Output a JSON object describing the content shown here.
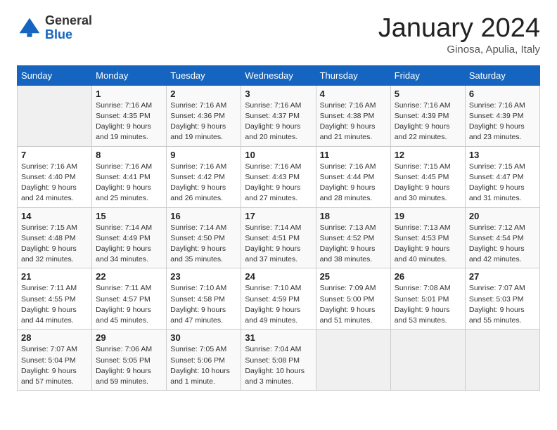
{
  "header": {
    "logo_general": "General",
    "logo_blue": "Blue",
    "month_title": "January 2024",
    "subtitle": "Ginosa, Apulia, Italy"
  },
  "days_of_week": [
    "Sunday",
    "Monday",
    "Tuesday",
    "Wednesday",
    "Thursday",
    "Friday",
    "Saturday"
  ],
  "weeks": [
    [
      {
        "num": "",
        "detail": ""
      },
      {
        "num": "1",
        "detail": "Sunrise: 7:16 AM\nSunset: 4:35 PM\nDaylight: 9 hours\nand 19 minutes."
      },
      {
        "num": "2",
        "detail": "Sunrise: 7:16 AM\nSunset: 4:36 PM\nDaylight: 9 hours\nand 19 minutes."
      },
      {
        "num": "3",
        "detail": "Sunrise: 7:16 AM\nSunset: 4:37 PM\nDaylight: 9 hours\nand 20 minutes."
      },
      {
        "num": "4",
        "detail": "Sunrise: 7:16 AM\nSunset: 4:38 PM\nDaylight: 9 hours\nand 21 minutes."
      },
      {
        "num": "5",
        "detail": "Sunrise: 7:16 AM\nSunset: 4:39 PM\nDaylight: 9 hours\nand 22 minutes."
      },
      {
        "num": "6",
        "detail": "Sunrise: 7:16 AM\nSunset: 4:39 PM\nDaylight: 9 hours\nand 23 minutes."
      }
    ],
    [
      {
        "num": "7",
        "detail": "Sunrise: 7:16 AM\nSunset: 4:40 PM\nDaylight: 9 hours\nand 24 minutes."
      },
      {
        "num": "8",
        "detail": "Sunrise: 7:16 AM\nSunset: 4:41 PM\nDaylight: 9 hours\nand 25 minutes."
      },
      {
        "num": "9",
        "detail": "Sunrise: 7:16 AM\nSunset: 4:42 PM\nDaylight: 9 hours\nand 26 minutes."
      },
      {
        "num": "10",
        "detail": "Sunrise: 7:16 AM\nSunset: 4:43 PM\nDaylight: 9 hours\nand 27 minutes."
      },
      {
        "num": "11",
        "detail": "Sunrise: 7:16 AM\nSunset: 4:44 PM\nDaylight: 9 hours\nand 28 minutes."
      },
      {
        "num": "12",
        "detail": "Sunrise: 7:15 AM\nSunset: 4:45 PM\nDaylight: 9 hours\nand 30 minutes."
      },
      {
        "num": "13",
        "detail": "Sunrise: 7:15 AM\nSunset: 4:47 PM\nDaylight: 9 hours\nand 31 minutes."
      }
    ],
    [
      {
        "num": "14",
        "detail": "Sunrise: 7:15 AM\nSunset: 4:48 PM\nDaylight: 9 hours\nand 32 minutes."
      },
      {
        "num": "15",
        "detail": "Sunrise: 7:14 AM\nSunset: 4:49 PM\nDaylight: 9 hours\nand 34 minutes."
      },
      {
        "num": "16",
        "detail": "Sunrise: 7:14 AM\nSunset: 4:50 PM\nDaylight: 9 hours\nand 35 minutes."
      },
      {
        "num": "17",
        "detail": "Sunrise: 7:14 AM\nSunset: 4:51 PM\nDaylight: 9 hours\nand 37 minutes."
      },
      {
        "num": "18",
        "detail": "Sunrise: 7:13 AM\nSunset: 4:52 PM\nDaylight: 9 hours\nand 38 minutes."
      },
      {
        "num": "19",
        "detail": "Sunrise: 7:13 AM\nSunset: 4:53 PM\nDaylight: 9 hours\nand 40 minutes."
      },
      {
        "num": "20",
        "detail": "Sunrise: 7:12 AM\nSunset: 4:54 PM\nDaylight: 9 hours\nand 42 minutes."
      }
    ],
    [
      {
        "num": "21",
        "detail": "Sunrise: 7:11 AM\nSunset: 4:55 PM\nDaylight: 9 hours\nand 44 minutes."
      },
      {
        "num": "22",
        "detail": "Sunrise: 7:11 AM\nSunset: 4:57 PM\nDaylight: 9 hours\nand 45 minutes."
      },
      {
        "num": "23",
        "detail": "Sunrise: 7:10 AM\nSunset: 4:58 PM\nDaylight: 9 hours\nand 47 minutes."
      },
      {
        "num": "24",
        "detail": "Sunrise: 7:10 AM\nSunset: 4:59 PM\nDaylight: 9 hours\nand 49 minutes."
      },
      {
        "num": "25",
        "detail": "Sunrise: 7:09 AM\nSunset: 5:00 PM\nDaylight: 9 hours\nand 51 minutes."
      },
      {
        "num": "26",
        "detail": "Sunrise: 7:08 AM\nSunset: 5:01 PM\nDaylight: 9 hours\nand 53 minutes."
      },
      {
        "num": "27",
        "detail": "Sunrise: 7:07 AM\nSunset: 5:03 PM\nDaylight: 9 hours\nand 55 minutes."
      }
    ],
    [
      {
        "num": "28",
        "detail": "Sunrise: 7:07 AM\nSunset: 5:04 PM\nDaylight: 9 hours\nand 57 minutes."
      },
      {
        "num": "29",
        "detail": "Sunrise: 7:06 AM\nSunset: 5:05 PM\nDaylight: 9 hours\nand 59 minutes."
      },
      {
        "num": "30",
        "detail": "Sunrise: 7:05 AM\nSunset: 5:06 PM\nDaylight: 10 hours\nand 1 minute."
      },
      {
        "num": "31",
        "detail": "Sunrise: 7:04 AM\nSunset: 5:08 PM\nDaylight: 10 hours\nand 3 minutes."
      },
      {
        "num": "",
        "detail": ""
      },
      {
        "num": "",
        "detail": ""
      },
      {
        "num": "",
        "detail": ""
      }
    ]
  ]
}
